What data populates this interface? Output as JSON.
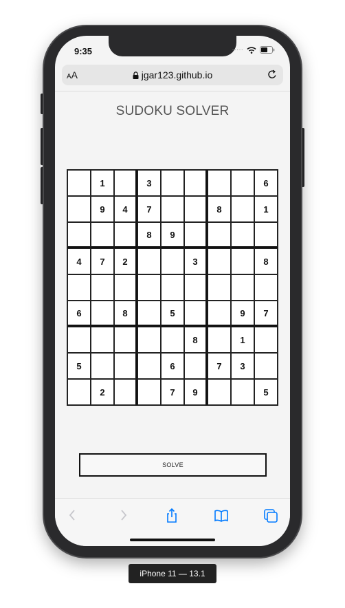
{
  "status_bar": {
    "time": "9:35"
  },
  "browser": {
    "aa_label_small": "A",
    "aa_label_large": "A",
    "url": "jgar123.github.io",
    "accent_color": "#007aff"
  },
  "page": {
    "title": "SUDOKU SOLVER",
    "solve_label": "SOLVE"
  },
  "sudoku": {
    "rows": [
      [
        "",
        "1",
        "",
        "3",
        "",
        "",
        "",
        "",
        "6"
      ],
      [
        "",
        "9",
        "4",
        "7",
        "",
        "",
        "8",
        "",
        "1"
      ],
      [
        "",
        "",
        "",
        "8",
        "9",
        "",
        "",
        "",
        ""
      ],
      [
        "4",
        "7",
        "2",
        "",
        "",
        "3",
        "",
        "",
        "8"
      ],
      [
        "",
        "",
        "",
        "",
        "",
        "",
        "",
        "",
        ""
      ],
      [
        "6",
        "",
        "8",
        "",
        "5",
        "",
        "",
        "9",
        "7"
      ],
      [
        "",
        "",
        "",
        "",
        "",
        "8",
        "",
        "1",
        ""
      ],
      [
        "5",
        "",
        "",
        "",
        "6",
        "",
        "7",
        "3",
        ""
      ],
      [
        "",
        "2",
        "",
        "",
        "7",
        "9",
        "",
        "",
        "5"
      ]
    ]
  },
  "toolbar": {
    "icons": [
      "back-icon",
      "forward-icon",
      "share-icon",
      "bookmarks-icon",
      "tabs-icon"
    ]
  },
  "device_label": "iPhone 11 — 13.1"
}
